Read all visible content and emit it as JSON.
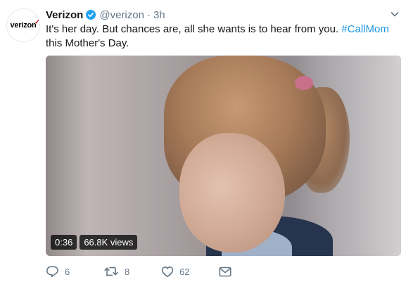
{
  "tweet": {
    "avatar": {
      "logo_text": "verizon"
    },
    "author": {
      "name": "Verizon",
      "handle": "@verizon",
      "separator": "·",
      "time": "3h",
      "verified": true
    },
    "text_before": "It's her day. But chances are, all she wants is to hear from you. ",
    "hashtag": "#CallMom",
    "text_after": " this Mother's Day.",
    "media": {
      "duration": "0:36",
      "views": "66.8K views"
    },
    "actions": {
      "replies": "6",
      "retweets": "8",
      "likes": "62"
    }
  },
  "icons": {
    "verified": "verified-badge-icon",
    "caret": "chevron-down-icon",
    "reply": "reply-icon",
    "retweet": "retweet-icon",
    "like": "heart-icon",
    "dm": "envelope-icon"
  },
  "colors": {
    "accent": "#1da1f2",
    "hashtag": "#1b95e0",
    "muted": "#657786",
    "logo_check": "#cd040b"
  }
}
